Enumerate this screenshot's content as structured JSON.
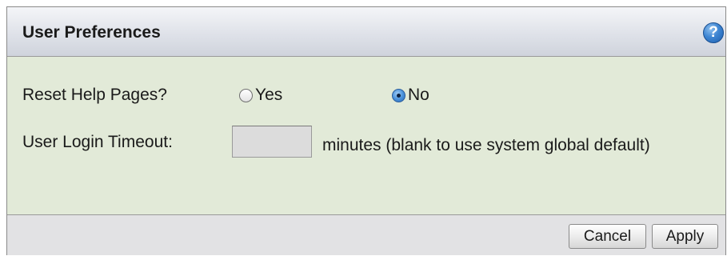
{
  "dialog": {
    "title": "User Preferences",
    "help_icon": "help-icon",
    "help_glyph": "?"
  },
  "form": {
    "reset_help": {
      "label": "Reset Help Pages?",
      "options": [
        {
          "label": "Yes",
          "checked": false
        },
        {
          "label": "No",
          "checked": true
        }
      ]
    },
    "timeout": {
      "label": "User Login Timeout:",
      "value": "",
      "placeholder": "",
      "hint": "minutes (blank to use system global default)"
    }
  },
  "footer": {
    "cancel_label": "Cancel",
    "apply_label": "Apply"
  },
  "colors": {
    "body_bg": "#e2ead8",
    "header_bg": "#dfe2e9",
    "footer_bg": "#e2e2e4",
    "help_icon_blue": "#3f86d3"
  }
}
